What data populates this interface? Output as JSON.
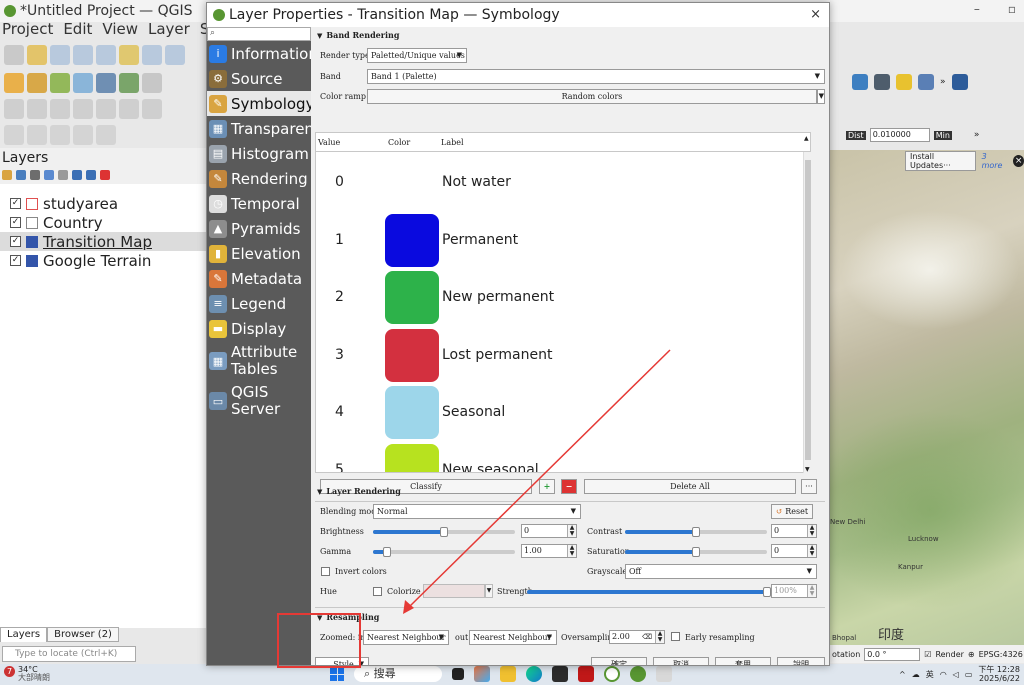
{
  "qgis": {
    "title": "*Untitled Project — QGIS",
    "menu": [
      "Project",
      "Edit",
      "View",
      "Layer",
      "Sett"
    ],
    "layers_title": "Layers",
    "layers": [
      {
        "name": "studyarea",
        "checked": "✓",
        "selected": false,
        "symbol_color": "#ffffff",
        "symbol_border": "#e05050"
      },
      {
        "name": "Country",
        "checked": "✓",
        "selected": false,
        "symbol_color": "#ffffff",
        "symbol_border": "#888888"
      },
      {
        "name": "Transition Map",
        "checked": "✓",
        "selected": true,
        "symbol_color": "#3355aa",
        "symbol_border": "#3355aa"
      },
      {
        "name": "Google Terrain",
        "checked": "✓",
        "selected": false,
        "symbol_color": "#3355aa",
        "symbol_border": "#3355aa"
      }
    ],
    "bottom_tabs": [
      "Layers",
      "Browser (2)"
    ],
    "locator_placeholder": "Type to locate (Ctrl+K)",
    "dist_label": "Dist",
    "dist_value": "0.010000",
    "min_label": "Min",
    "install_updates": "Install Updates···",
    "more_label": "3 more",
    "rotation_label": "otation",
    "rotation_value": "0.0 °",
    "render_label": "Render",
    "crs_label": "EPSG:4326",
    "map_labels": {
      "new_delhi": "New Delhi",
      "lucknow": "Lucknow",
      "kanpur": "Kanpur",
      "bhopal": "Bhopal",
      "india": "印度"
    }
  },
  "taskbar": {
    "weather_badge": "7",
    "temperature": "34°C",
    "weather_sub": "大部晴朗",
    "search": "搜尋",
    "ime": "英",
    "time": "下午 12:28",
    "date": "2025/6/22"
  },
  "dialog": {
    "title": "Layer Properties - Transition Map — Symbology",
    "close_icon": "×",
    "search_placeholder": "",
    "sidebar": [
      {
        "label": "Information",
        "icon": "info-icon",
        "color": "#2a7be4",
        "glyph": "i"
      },
      {
        "label": "Source",
        "icon": "source-icon",
        "color": "#8a6d3b",
        "glyph": "⚙"
      },
      {
        "label": "Symbology",
        "icon": "symbology-icon",
        "color": "#d9a441",
        "glyph": "✎",
        "active": true
      },
      {
        "label": "Transparency",
        "icon": "transparency-icon",
        "color": "#6b8fb5",
        "glyph": "▦"
      },
      {
        "label": "Histogram",
        "icon": "histogram-icon",
        "color": "#9aa3ad",
        "glyph": "▤"
      },
      {
        "label": "Rendering",
        "icon": "rendering-icon",
        "color": "#c4873c",
        "glyph": "✎"
      },
      {
        "label": "Temporal",
        "icon": "temporal-icon",
        "color": "#dddddd",
        "glyph": "◷"
      },
      {
        "label": "Pyramids",
        "icon": "pyramids-icon",
        "color": "#8d8d8d",
        "glyph": "▲"
      },
      {
        "label": "Elevation",
        "icon": "elevation-icon",
        "color": "#e0b33a",
        "glyph": "▮"
      },
      {
        "label": "Metadata",
        "icon": "metadata-icon",
        "color": "#d9763a",
        "glyph": "✎"
      },
      {
        "label": "Legend",
        "icon": "legend-icon",
        "color": "#6d8fb0",
        "glyph": "≡"
      },
      {
        "label": "Display",
        "icon": "display-icon",
        "color": "#e9c43a",
        "glyph": "▬"
      },
      {
        "label": "Attribute Tables",
        "icon": "attribute-tables-icon",
        "color": "#7a9cc0",
        "glyph": "▦",
        "multi": true
      },
      {
        "label": "QGIS Server",
        "icon": "qgis-server-icon",
        "color": "#6b89a8",
        "glyph": "▭",
        "multi": true
      }
    ],
    "band_rendering": {
      "heading": "Band Rendering",
      "render_type_label": "Render type",
      "render_type": "Paletted/Unique values",
      "band_label": "Band",
      "band": "Band 1 (Palette)",
      "color_ramp_label": "Color ramp",
      "color_ramp": "Random colors",
      "columns": [
        "Value",
        "Color",
        "Label"
      ],
      "classes": [
        {
          "value": "0",
          "color": "",
          "label": "Not water"
        },
        {
          "value": "1",
          "color": "#0a0adf",
          "label": "Permanent"
        },
        {
          "value": "2",
          "color": "#2db24a",
          "label": "New permanent"
        },
        {
          "value": "3",
          "color": "#d3303f",
          "label": "Lost permanent"
        },
        {
          "value": "4",
          "color": "#9dd6ea",
          "label": "Seasonal"
        },
        {
          "value": "5",
          "color": "#b7e21f",
          "label": "New seasonal"
        }
      ],
      "classify": "Classify",
      "add_icon": "+",
      "remove_icon": "−",
      "delete_all": "Delete All",
      "more_icon": "···"
    },
    "layer_rendering": {
      "heading": "Layer Rendering",
      "blending_label": "Blending mode",
      "blending": "Normal",
      "reset": "Reset",
      "brightness_label": "Brightness",
      "brightness": "0",
      "brightness_level": 0.5,
      "contrast_label": "Contrast",
      "contrast": "0",
      "contrast_level": 0.5,
      "gamma_label": "Gamma",
      "gamma": "1.00",
      "gamma_level": 0.1,
      "saturation_label": "Saturation",
      "saturation": "0",
      "saturation_level": 0.5,
      "invert_label": "Invert colors",
      "grayscale_label": "Grayscale",
      "grayscale": "Off",
      "hue_label": "Hue",
      "colorize_label": "Colorize",
      "strength_label": "Strength",
      "strength": "100%",
      "strength_level": 1.0
    },
    "resampling": {
      "heading": "Resampling",
      "zoomed_in_label": "Zoomed: in",
      "zoomed_in": "Nearest Neighbour",
      "out_label": "out",
      "zoomed_out": "Nearest Neighbour",
      "oversampling_label": "Oversampling",
      "oversampling": "2.00",
      "early_label": "Early resampling"
    },
    "footer": {
      "style": "Style",
      "ok": "確定",
      "cancel": "取消",
      "apply": "套用",
      "help": "說明"
    }
  },
  "annotation": {
    "color": "#e53935"
  }
}
